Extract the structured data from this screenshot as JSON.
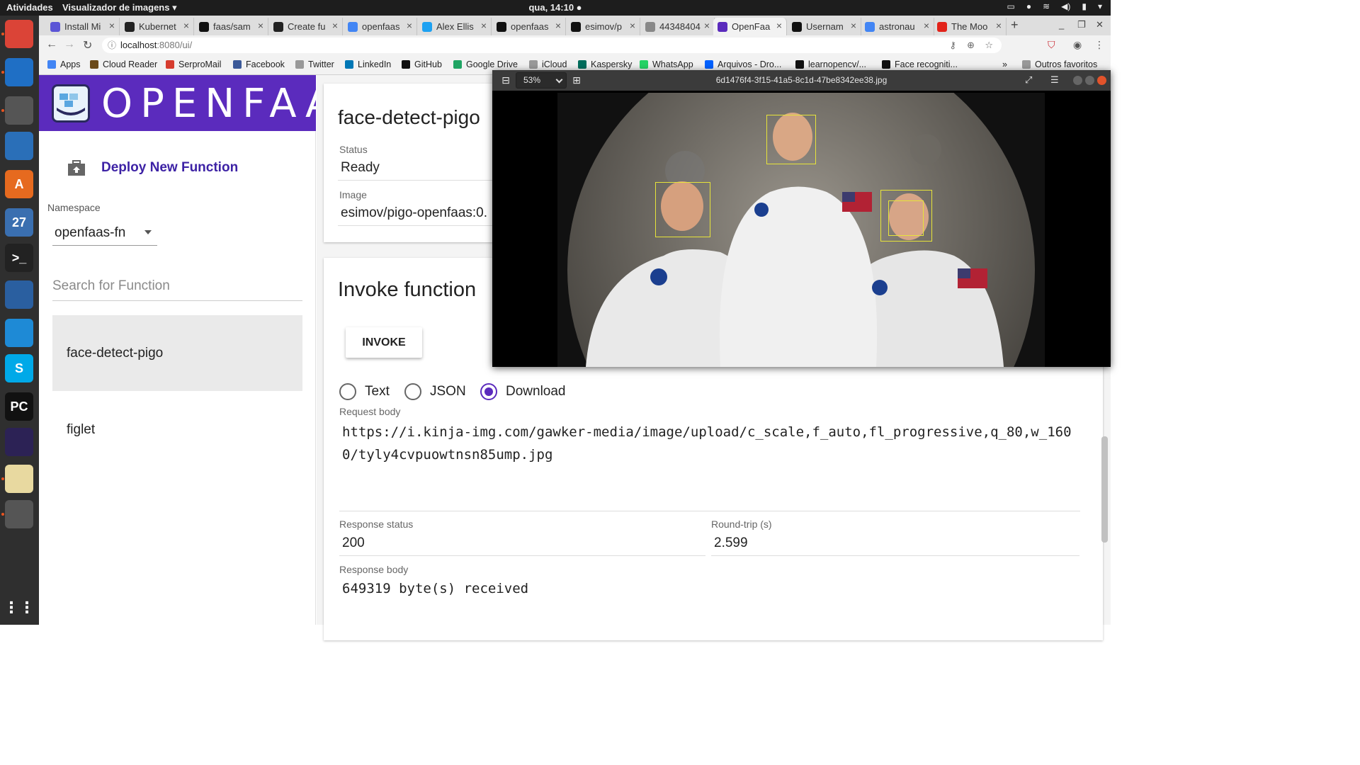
{
  "topbar": {
    "activities": "Atividades",
    "app": "Visualizador de imagens ▾",
    "clock": "qua, 14:10 ●"
  },
  "dock": {
    "apps": [
      {
        "name": "chrome",
        "color": "#db4437",
        "label": ""
      },
      {
        "name": "thunderbird",
        "color": "#1f6fc5",
        "label": ""
      },
      {
        "name": "files",
        "color": "#555",
        "label": ""
      },
      {
        "name": "libreoffice-writer",
        "color": "#2a6fb8",
        "label": ""
      },
      {
        "name": "software-center",
        "color": "#e66a1f",
        "label": "A"
      },
      {
        "name": "calendar",
        "color": "#3a6fb0",
        "label": "27"
      },
      {
        "name": "terminal",
        "color": "#222",
        "label": ">_"
      },
      {
        "name": "virtualbox",
        "color": "#2a5fa0",
        "label": ""
      },
      {
        "name": "vscode",
        "color": "#1e8ad6",
        "label": ""
      },
      {
        "name": "skype",
        "color": "#00a9e8",
        "label": "S"
      },
      {
        "name": "pycharm",
        "color": "#111",
        "label": "PC"
      },
      {
        "name": "eclipse",
        "color": "#2c2255",
        "label": ""
      },
      {
        "name": "text-editor",
        "color": "#e8d9a0",
        "label": ""
      },
      {
        "name": "image-viewer",
        "color": "#555",
        "label": ""
      }
    ]
  },
  "tabs": [
    {
      "label": "Install Mi",
      "color": "#5b55d6",
      "active": false
    },
    {
      "label": "Kubernet",
      "color": "#222",
      "active": false
    },
    {
      "label": "faas/sam",
      "color": "#111",
      "active": false
    },
    {
      "label": "Create fu",
      "color": "#222",
      "active": false
    },
    {
      "label": "openfaas",
      "color": "#4285f4",
      "active": false
    },
    {
      "label": "Alex Ellis",
      "color": "#1da1f2",
      "active": false
    },
    {
      "label": "openfaas",
      "color": "#111",
      "active": false
    },
    {
      "label": "esimov/p",
      "color": "#111",
      "active": false
    },
    {
      "label": "44348404",
      "color": "#888",
      "active": false
    },
    {
      "label": "OpenFaa",
      "color": "#5b2bbd",
      "active": true
    },
    {
      "label": "Usernam",
      "color": "#111",
      "active": false
    },
    {
      "label": "astronau",
      "color": "#4285f4",
      "active": false
    },
    {
      "label": "The Moo",
      "color": "#e2231a",
      "active": false
    }
  ],
  "address": {
    "host": "localhost",
    "path": ":8080/ui/"
  },
  "bookmarks": [
    {
      "label": "Apps",
      "color": "#4285f4"
    },
    {
      "label": "Cloud Reader",
      "color": "#6b4a1a"
    },
    {
      "label": "SerproMail",
      "color": "#d63c2e"
    },
    {
      "label": "Facebook",
      "color": "#3b5998"
    },
    {
      "label": "Twitter",
      "color": "#999"
    },
    {
      "label": "LinkedIn",
      "color": "#0077b5"
    },
    {
      "label": "GitHub",
      "color": "#111"
    },
    {
      "label": "Google Drive",
      "color": "#1fa463"
    },
    {
      "label": "iCloud",
      "color": "#999"
    },
    {
      "label": "Kaspersky",
      "color": "#006d5c"
    },
    {
      "label": "WhatsApp",
      "color": "#25d366"
    },
    {
      "label": "Arquivos - Dro...",
      "color": "#0061ff"
    },
    {
      "label": "learnopencv/...",
      "color": "#111"
    },
    {
      "label": "Face recogniti...",
      "color": "#111"
    }
  ],
  "bookmarks_more": "»",
  "bookmarks_other": "Outros favoritos",
  "sidebar": {
    "logo_text": "OPENFAAS",
    "deploy_label": "Deploy New Function",
    "namespace_label": "Namespace",
    "namespace_value": "openfaas-fn",
    "search_placeholder": "Search for Function",
    "functions": [
      "face-detect-pigo",
      "figlet"
    ]
  },
  "details": {
    "title": "face-detect-pigo",
    "status_label": "Status",
    "status_value": "Ready",
    "image_label": "Image",
    "image_value": "esimov/pigo-openfaas:0."
  },
  "invoke": {
    "title": "Invoke function",
    "button": "INVOKE",
    "options": [
      "Text",
      "JSON",
      "Download"
    ],
    "selected": "Download",
    "request_label": "Request body",
    "request_body": "https://i.kinja-img.com/gawker-media/image/upload/c_scale,f_auto,fl_progressive,q_80,w_1600/tyly4cvpuowtnsn85ump.jpg",
    "status_label": "Response status",
    "status_value": "200",
    "roundtrip_label": "Round-trip (s)",
    "roundtrip_value": "2.599",
    "response_label": "Response body",
    "response_value": "649319 byte(s) received"
  },
  "viewer": {
    "zoom": "53%",
    "filename": "6d1476f4-3f15-41a5-8c1d-47be8342ee38.jpg"
  }
}
